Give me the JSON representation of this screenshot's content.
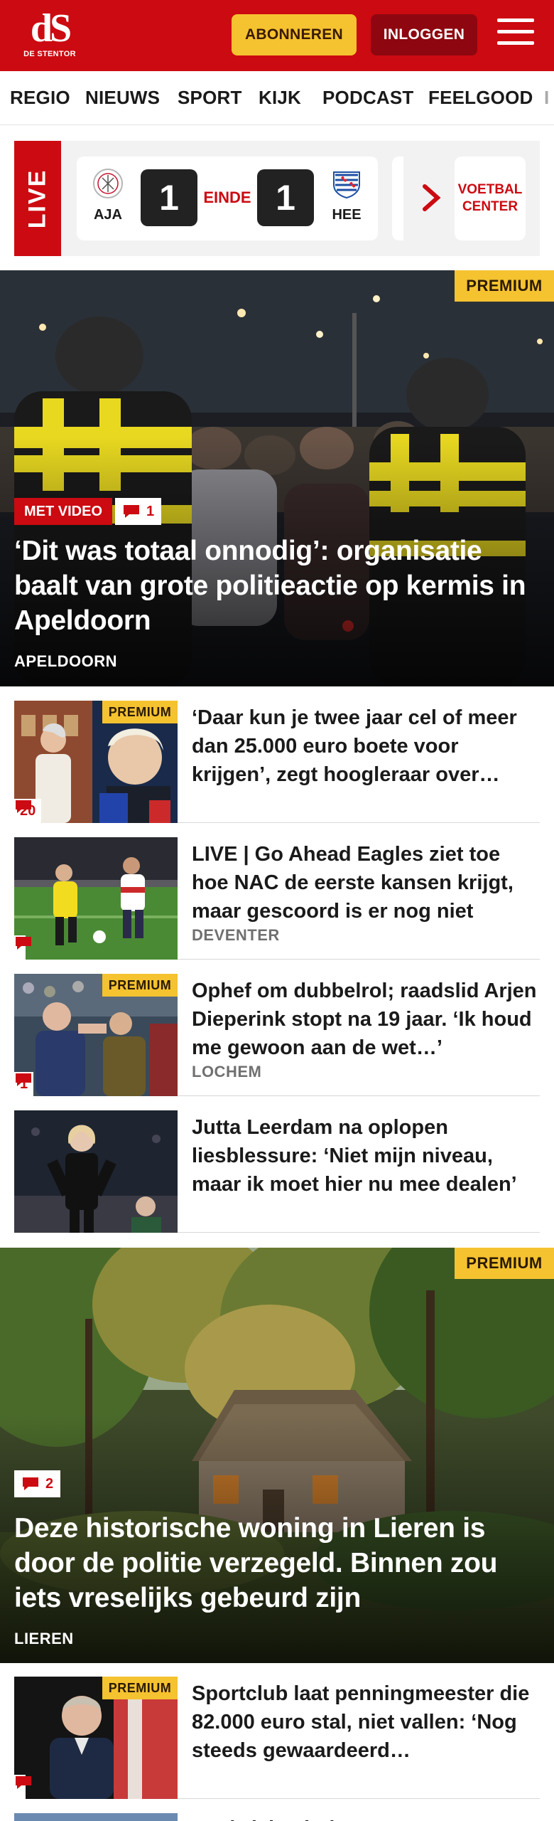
{
  "header": {
    "logo_mark": "dS",
    "logo_sub": "DE STENTOR",
    "subscribe_label": "ABONNEREN",
    "login_label": "INLOGGEN"
  },
  "nav": {
    "items": [
      "REGIO",
      "NIEUWS",
      "SPORT",
      "KIJK",
      "PODCAST",
      "FEELGOOD",
      "I"
    ]
  },
  "live": {
    "label": "LIVE",
    "home_team": "AJA",
    "away_team": "HEE",
    "home_score": "1",
    "away_score": "1",
    "status": "EINDE",
    "center_label_1": "VOETBAL",
    "center_label_2": "CENTER"
  },
  "hero1": {
    "premium": "PREMIUM",
    "video_label": "MET VIDEO",
    "comments": "1",
    "title": "‘Dit was totaal onnodig’: organisatie baalt van grote politieactie op kermis in Apeldoorn",
    "location": "APELDOORN"
  },
  "articles": [
    {
      "premium": "PREMIUM",
      "comments": "20",
      "title": "‘Daar kun je twee jaar cel of meer dan 25.000 euro boete voor krijgen’, zegt hoogleraar over…",
      "location": ""
    },
    {
      "premium": "",
      "comments": "",
      "title": "LIVE | Go Ahead Eagles ziet toe hoe NAC de eerste kansen krijgt, maar gescoord is er nog niet",
      "location": "DEVENTER"
    },
    {
      "premium": "PREMIUM",
      "comments": "1",
      "title": "Ophef om dubbelrol; raadslid Arjen Dieperink stopt na 19 jaar. ‘Ik houd me gewoon aan de wet…’",
      "location": "LOCHEM"
    },
    {
      "premium": "",
      "comments": "",
      "title": "Jutta Leerdam na oplopen liesblessure: ‘Niet mijn niveau, maar ik moet hier nu mee dealen’",
      "location": ""
    }
  ],
  "hero2": {
    "premium": "PREMIUM",
    "comments": "2",
    "title": "Deze historische woning in Lieren is door de politie verzegeld. Binnen zou iets vreselijks gebeurd zijn",
    "location": "LIEREN"
  },
  "article5": {
    "premium": "PREMIUM",
    "comments": "",
    "title": "Sportclub laat penningmeester die 82.000 euro stal, niet vallen: ‘Nog steeds gewaardeerd…",
    "location": ""
  },
  "article6": {
    "title": "Deel ziekenhuis weer open: Deventer"
  },
  "colors": {
    "brand_red": "#cc0a11",
    "premium_yellow": "#f5c230",
    "login_dark_red": "#8e0710"
  },
  "icons": [
    "hamburger-icon",
    "chevron-right-icon",
    "comment-icon",
    "ajax-logo-icon",
    "heerenveen-logo-icon"
  ]
}
